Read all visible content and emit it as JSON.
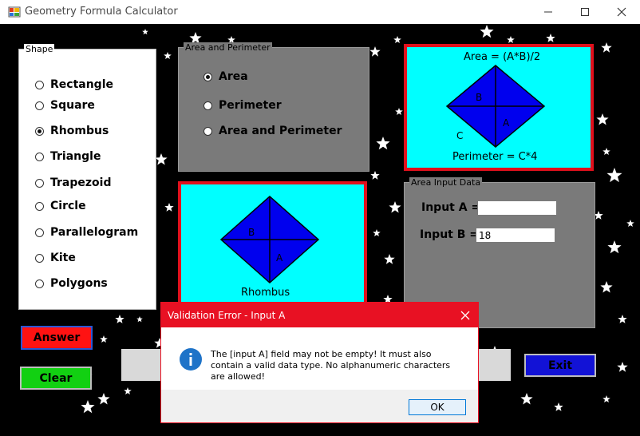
{
  "window": {
    "title": "Geometry Formula Calculator"
  },
  "shape_group": {
    "legend": "Shape",
    "options": [
      {
        "label": "Rectangle",
        "checked": false
      },
      {
        "label": "Square",
        "checked": false
      },
      {
        "label": "Rhombus",
        "checked": true
      },
      {
        "label": "Triangle",
        "checked": false
      },
      {
        "label": "Trapezoid",
        "checked": false
      },
      {
        "label": "Circle",
        "checked": false
      },
      {
        "label": "Parallelogram",
        "checked": false
      },
      {
        "label": "Kite",
        "checked": false
      },
      {
        "label": "Polygons",
        "checked": false
      }
    ]
  },
  "calc_group": {
    "legend": "Area and Perimeter",
    "options": [
      {
        "label": "Area",
        "checked": true
      },
      {
        "label": "Perimeter",
        "checked": false
      },
      {
        "label": "Area and Perimeter",
        "checked": false
      }
    ]
  },
  "formula_panel": {
    "area_formula": "Area = (A*B)/2",
    "perimeter_formula": "Perimeter = C*4",
    "label_a": "A",
    "label_b": "B",
    "label_c": "C"
  },
  "shape_panel": {
    "caption": "Rhombus",
    "label_a": "A",
    "label_b": "B"
  },
  "input_group": {
    "legend": "Area Input Data",
    "input_a_label": "Input A =",
    "input_a_value": "",
    "input_b_label": "Input B =",
    "input_b_value": "18"
  },
  "buttons": {
    "answer": "Answer",
    "clear": "Clear",
    "exit": "Exit"
  },
  "dialog": {
    "title": "Validation Error - Input A",
    "message": "The [input A] field may not be empty! It must also contain a valid data type. No alphanumeric characters are allowed!",
    "ok": "OK"
  },
  "colors": {
    "rhombus_fill": "#0000ee",
    "panel_cyan": "#00ffff",
    "panel_border": "#e0101c",
    "answer_button": "#ff1212",
    "clear_button": "#12d012",
    "exit_button": "#1212d6",
    "dialog_accent": "#e81123"
  }
}
